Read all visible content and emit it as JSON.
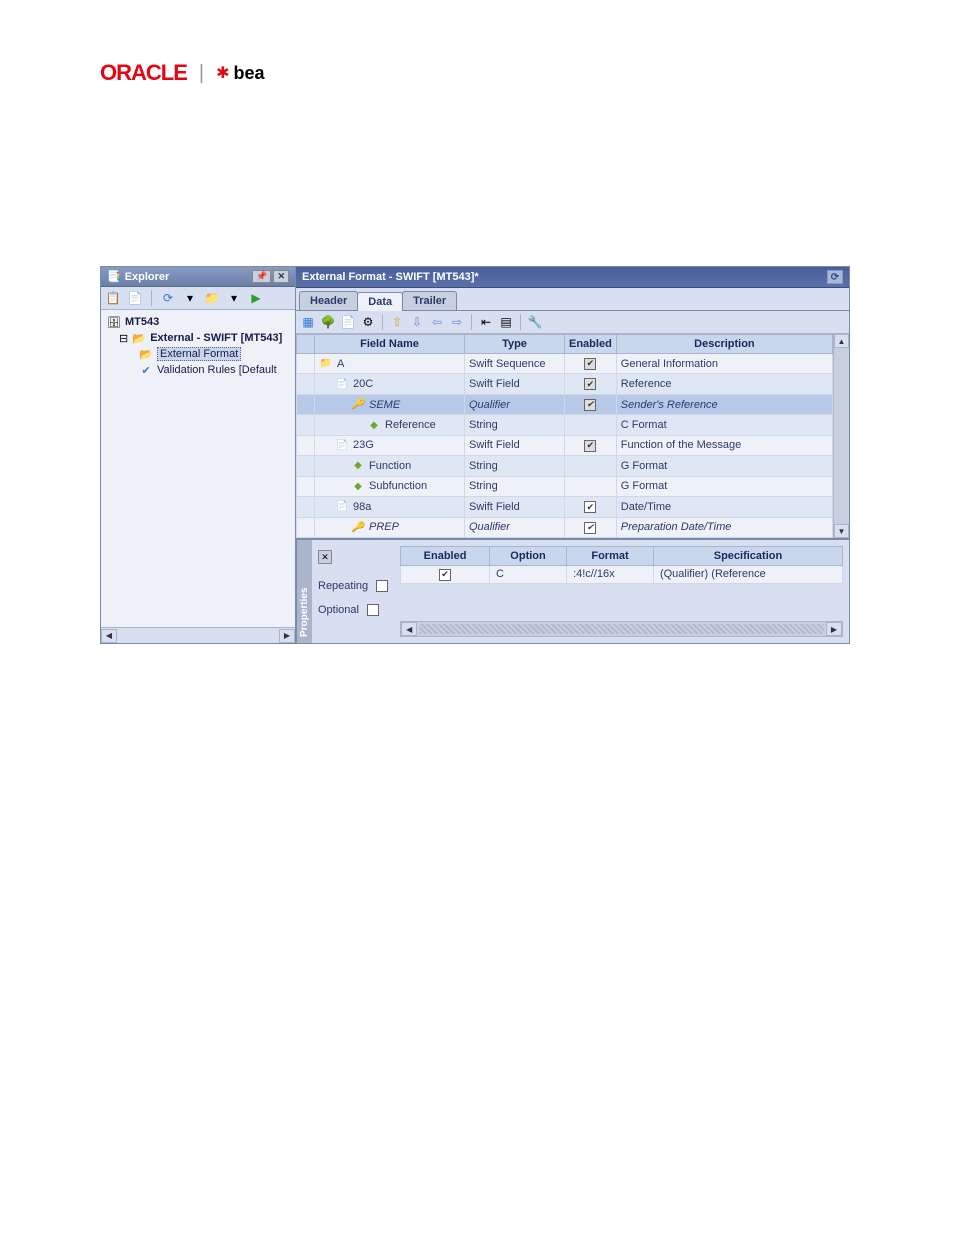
{
  "logos": {
    "oracle": "ORACLE",
    "sep": "|",
    "bea": "bea"
  },
  "explorer": {
    "title": "Explorer",
    "tree": {
      "root": "MT543",
      "external": "External - SWIFT [MT543]",
      "external_format": "External Format",
      "validation": "Validation Rules [Default"
    }
  },
  "main": {
    "title": "External Format - SWIFT [MT543]*",
    "tabs": {
      "header": "Header",
      "data": "Data",
      "trailer": "Trailer"
    },
    "columns": {
      "field": "Field Name",
      "type": "Type",
      "enabled": "Enabled",
      "desc": "Description"
    },
    "rows": [
      {
        "indent": 0,
        "icon": "📁",
        "name": "A",
        "type": "Swift Sequence",
        "enabled": "disabled-checked",
        "desc": "General Information",
        "alt": false
      },
      {
        "indent": 1,
        "icon": "📄",
        "name": "20C",
        "type": "Swift Field",
        "enabled": "disabled-checked",
        "desc": "Reference",
        "alt": true
      },
      {
        "indent": 2,
        "icon": "🔑",
        "name": "SEME",
        "type": "Qualifier",
        "enabled": "disabled-checked",
        "desc": "Sender's Reference",
        "alt": false,
        "selected": true,
        "italic": true
      },
      {
        "indent": 3,
        "icon": "◆",
        "name": "Reference",
        "type": "String",
        "enabled": "",
        "desc": "C Format",
        "alt": true
      },
      {
        "indent": 1,
        "icon": "📄",
        "name": "23G",
        "type": "Swift Field",
        "enabled": "disabled-checked",
        "desc": "Function of the Message",
        "alt": false
      },
      {
        "indent": 2,
        "icon": "◆",
        "name": "Function",
        "type": "String",
        "enabled": "",
        "desc": "G Format",
        "alt": true
      },
      {
        "indent": 2,
        "icon": "◆",
        "name": "Subfunction",
        "type": "String",
        "enabled": "",
        "desc": "G Format",
        "alt": false
      },
      {
        "indent": 1,
        "icon": "📄",
        "name": "98a",
        "type": "Swift Field",
        "enabled": "checked",
        "desc": "Date/Time",
        "alt": true
      },
      {
        "indent": 2,
        "icon": "🔑",
        "name": "PREP",
        "type": "Qualifier",
        "enabled": "checked",
        "desc": "Preparation Date/Time",
        "alt": false,
        "italic": true
      }
    ]
  },
  "props": {
    "title": "Properties",
    "repeating": "Repeating",
    "optional": "Optional",
    "columns": {
      "enabled": "Enabled",
      "option": "Option",
      "format": "Format",
      "spec": "Specification"
    },
    "row": {
      "option": "C",
      "format": ":4!c//16x",
      "spec": "(Qualifier) (Reference"
    }
  }
}
